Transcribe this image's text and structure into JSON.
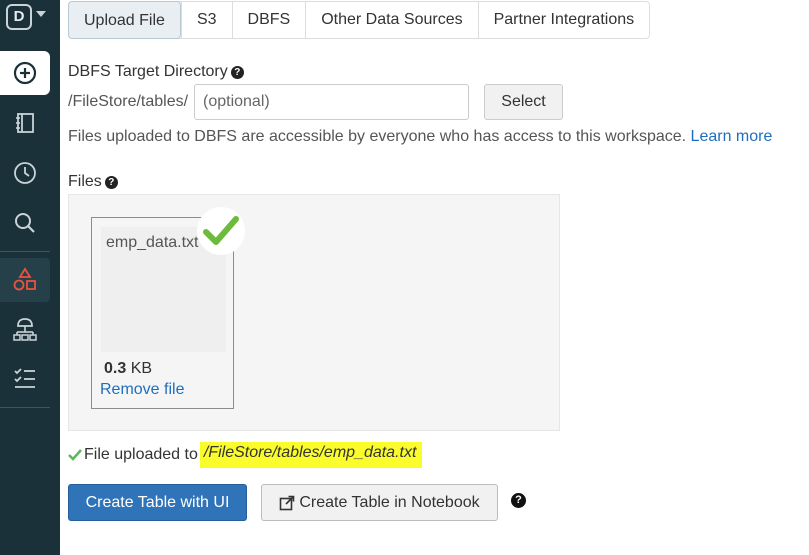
{
  "sidebar": {
    "logo_letter": "D",
    "items": [
      {
        "icon": "create-plus-icon"
      },
      {
        "icon": "workspace-icon"
      },
      {
        "icon": "recents-clock-icon"
      },
      {
        "icon": "search-icon"
      },
      {
        "icon": "data-shapes-icon"
      },
      {
        "icon": "clusters-icon"
      },
      {
        "icon": "jobs-checklist-icon"
      }
    ]
  },
  "tabs": [
    {
      "label": "Upload File",
      "active": true
    },
    {
      "label": "S3"
    },
    {
      "label": "DBFS"
    },
    {
      "label": "Other Data Sources"
    },
    {
      "label": "Partner Integrations"
    }
  ],
  "target_dir": {
    "label": "DBFS Target Directory",
    "prefix": "/FileStore/tables/",
    "placeholder": "(optional)",
    "select_label": "Select"
  },
  "info": {
    "text": "Files uploaded to DBFS are accessible by everyone who has access to this workspace.",
    "link": "Learn more"
  },
  "files": {
    "label": "Files",
    "items": [
      {
        "name": "emp_data.txt",
        "size_value": "0.3",
        "size_unit": "KB",
        "remove_label": "Remove file"
      }
    ]
  },
  "status": {
    "prefix": "File uploaded to",
    "path": "/FileStore/tables/emp_data.txt"
  },
  "actions": {
    "create_ui": "Create Table with UI",
    "create_notebook": "Create Table in Notebook"
  },
  "colors": {
    "sidebar_bg": "#1b3139",
    "primary": "#2f73b9",
    "link": "#1f6ebd",
    "success": "#5cb85c",
    "highlight": "#fbfc2c",
    "data_accent": "#e8533f"
  }
}
